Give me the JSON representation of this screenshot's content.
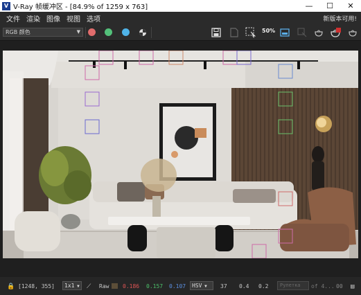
{
  "window": {
    "logo_text": "V",
    "title": "V-Ray 帧缓冲区 - [84.9% of 1259 x 763]",
    "minimize": "—",
    "maximize": "☐",
    "close": "✕"
  },
  "menu": {
    "items": [
      "文件",
      "渲染",
      "图像",
      "视图",
      "选项"
    ],
    "update": "新版本可用!"
  },
  "toolbar": {
    "channel": "RGB 颜色",
    "zoom_label": "50%",
    "colors": {
      "red": "#e06c6c",
      "green": "#53c07a",
      "blue": "#4fb3e8"
    }
  },
  "status": {
    "coords": "[1248, 355]",
    "ratio": "1x1",
    "raw_label": "Raw",
    "r": "0.186",
    "g": "0.157",
    "b": "0.107",
    "mode": "HSV",
    "h": "37",
    "s": "0.4",
    "v": "0.2",
    "pin_text": "Рулетка",
    "of_text": "of 4...",
    "tail": "00",
    "colors": {
      "r": "#e05555",
      "g": "#4cc06a",
      "b": "#5b8fe0",
      "swatch": "#5c4e38"
    }
  }
}
